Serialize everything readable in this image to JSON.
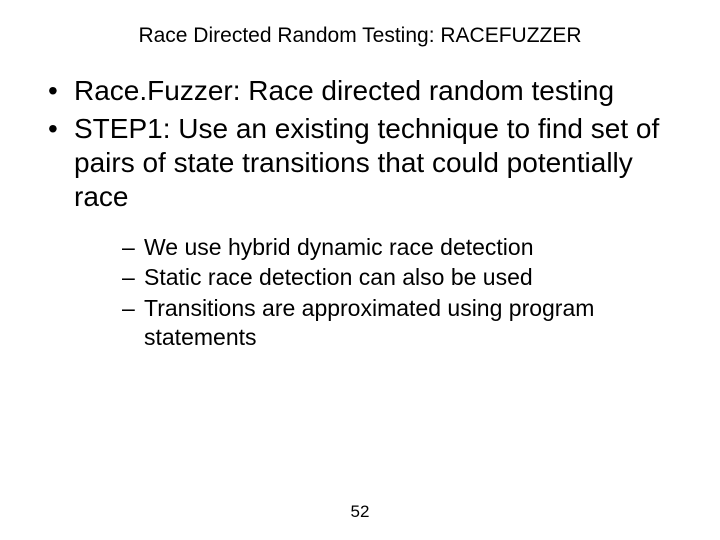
{
  "title": "Race Directed Random Testing: RACEFUZZER",
  "bullets": {
    "b1": "Race.Fuzzer: Race directed random testing",
    "b2": "STEP1: Use an existing technique to find set of pairs of state transitions that could potentially race"
  },
  "subbullets": {
    "s1": "We use hybrid dynamic race detection",
    "s2": "Static race detection can also be used",
    "s3": "Transitions are approximated using program statements"
  },
  "page_number": "52"
}
